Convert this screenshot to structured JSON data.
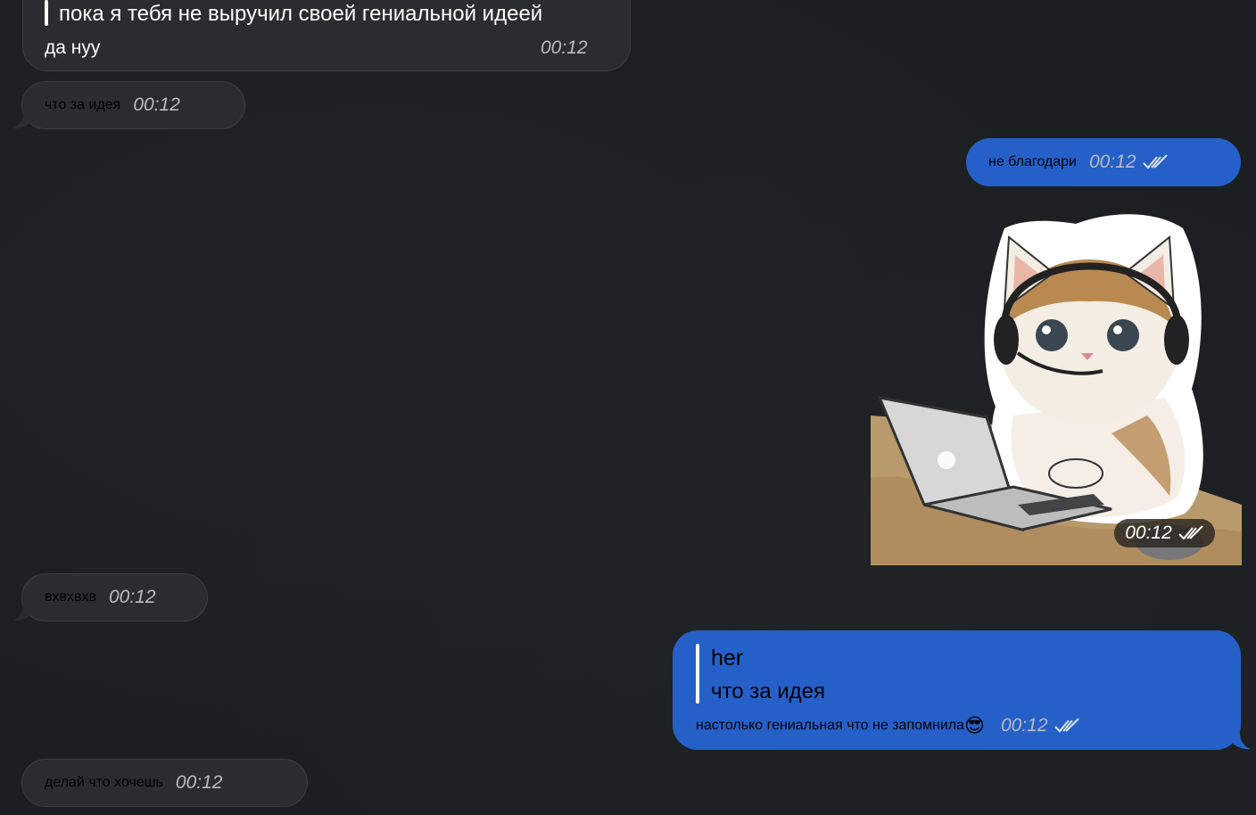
{
  "messages": {
    "m1": {
      "reply_text": "пока я тебя не выручил своей гениальной идеей",
      "text": "да нуу",
      "time": "00:12"
    },
    "m2": {
      "text": "что за идея",
      "time": "00:12"
    },
    "m3": {
      "text": "не благодари",
      "time": "00:12"
    },
    "sticker": {
      "time": "00:12",
      "description_icon": "cat-with-headset-laptop-sticker"
    },
    "m4": {
      "text": "вхвхвхв",
      "time": "00:12"
    },
    "m5": {
      "reply_author": "her",
      "reply_text": "что за идея",
      "text": "настолько гениальная что не запомнила",
      "emoji": "😎",
      "time": "00:12"
    },
    "m6": {
      "text": "делай что хочешь",
      "time": "00:12"
    }
  },
  "colors": {
    "background": "#1c1f21",
    "incoming_bubble": "#2a2d30",
    "outgoing_bubble": "#2560c9"
  }
}
